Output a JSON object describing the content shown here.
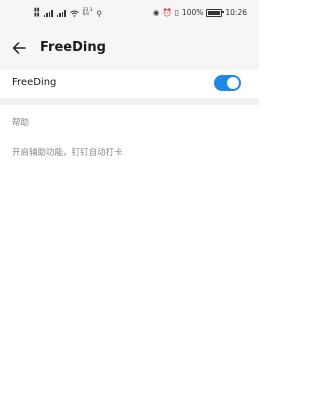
{
  "status_bar": {
    "net_speed": "23.3",
    "net_unit": "K/s",
    "battery_percent": "100%",
    "time": "10:26"
  },
  "app_bar": {
    "title": "FreeDing",
    "back_icon": "arrow-back-icon"
  },
  "settings": {
    "toggle_label": "FreeDing",
    "toggle_on": true,
    "accent_color": "#1e88e5",
    "section_header": "帮助",
    "help_text": "开启辅助功能，钉钉自动打卡"
  }
}
